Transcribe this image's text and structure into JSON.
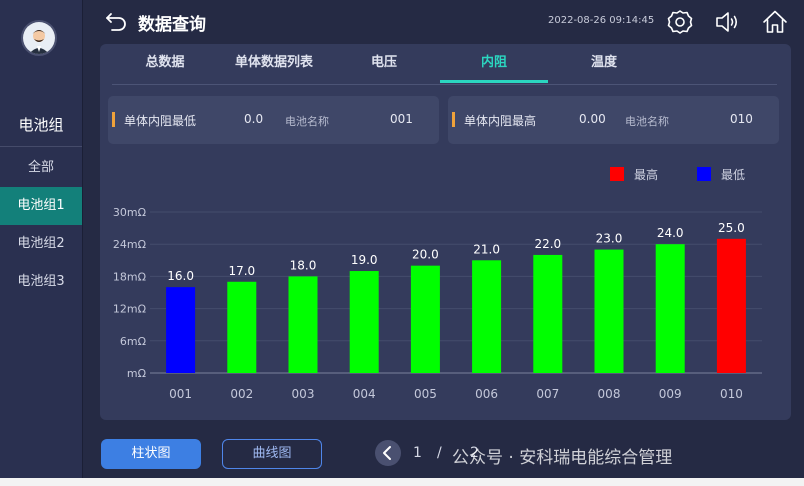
{
  "header": {
    "title": "数据查询",
    "datetime": "2022-08-26 09:14:45"
  },
  "sidebar": {
    "group_title": "电池组",
    "items": [
      {
        "label": "全部",
        "active": false
      },
      {
        "label": "电池组1",
        "active": true
      },
      {
        "label": "电池组2",
        "active": false
      },
      {
        "label": "电池组3",
        "active": false
      }
    ]
  },
  "tabs": [
    {
      "label": "总数据",
      "active": false
    },
    {
      "label": "单体数据列表",
      "active": false
    },
    {
      "label": "电压",
      "active": false
    },
    {
      "label": "内阻",
      "active": true
    },
    {
      "label": "温度",
      "active": false
    }
  ],
  "stats": {
    "min": {
      "label": "单体内阻最低",
      "value": "0.0",
      "name_label": "电池名称",
      "name_value": "001"
    },
    "max": {
      "label": "单体内阻最高",
      "value": "0.00",
      "name_label": "电池名称",
      "name_value": "010"
    }
  },
  "legend": {
    "high": {
      "label": "最高",
      "color": "#ff0000"
    },
    "low": {
      "label": "最低",
      "color": "#0000ff"
    }
  },
  "chart_data": {
    "type": "bar",
    "categories": [
      "001",
      "002",
      "003",
      "004",
      "005",
      "006",
      "007",
      "008",
      "009",
      "010"
    ],
    "values": [
      16.0,
      17.0,
      18.0,
      19.0,
      20.0,
      21.0,
      22.0,
      23.0,
      24.0,
      25.0
    ],
    "value_labels": [
      "16.0",
      "17.0",
      "18.0",
      "19.0",
      "20.0",
      "21.0",
      "22.0",
      "23.0",
      "24.0",
      "25.0"
    ],
    "colors": [
      "#0000ff",
      "#00ff00",
      "#00ff00",
      "#00ff00",
      "#00ff00",
      "#00ff00",
      "#00ff00",
      "#00ff00",
      "#00ff00",
      "#ff0000"
    ],
    "y_ticks": [
      "mΩ",
      "6mΩ",
      "12mΩ",
      "18mΩ",
      "24mΩ",
      "30mΩ"
    ],
    "ylim": [
      0,
      30
    ],
    "grid": true
  },
  "buttons": {
    "bar_chart": "柱状图",
    "line_chart": "曲线图"
  },
  "pager": {
    "current": "1",
    "separator": "/",
    "total_fragment": "2"
  },
  "watermark": "公众号 · 安科瑞电能综合管理",
  "icons": [
    "back-arrow-icon",
    "gear-icon",
    "speaker-icon",
    "home-icon",
    "avatar-icon",
    "chevron-left-icon"
  ]
}
